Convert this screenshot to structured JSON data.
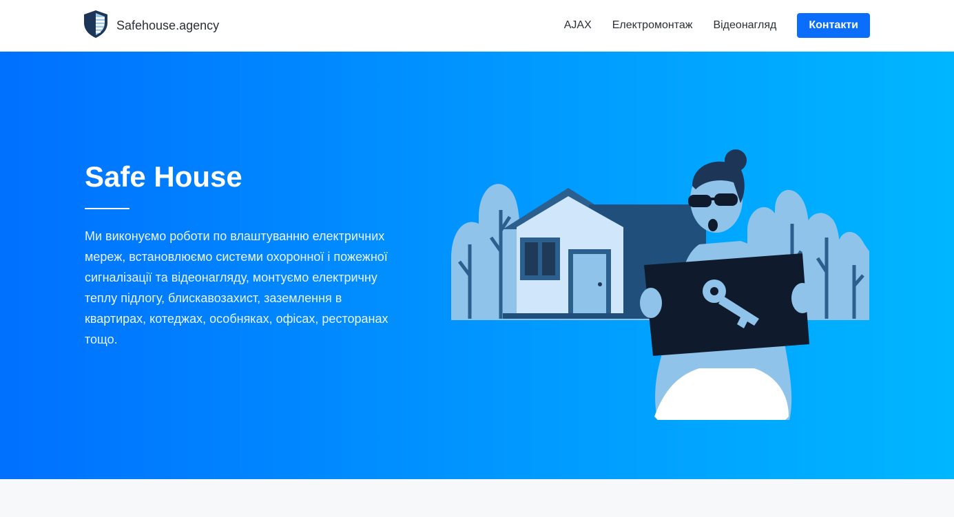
{
  "brand": {
    "name": "Safehouse.agency",
    "logo_icon": "shield-icon",
    "colors": {
      "shield_dark": "#1d3557",
      "shield_light": "#9cc8ea"
    }
  },
  "nav": {
    "items": [
      {
        "label": "AJAX"
      },
      {
        "label": "Електромонтаж"
      },
      {
        "label": "Відеонагляд"
      }
    ],
    "cta_label": "Контакти"
  },
  "hero": {
    "title": "Safe House",
    "description": "Ми виконуємо роботи по влаштуванню електричних мереж, встановлюємо системи охоронної і пожежної сигналізації та відеонагляду, монтуємо електричну теплу підлогу, блискавозахист, заземлення в квартирах, котеджах, особняках, офісах, ресторанах тощо.",
    "illustration": "woman-holding-key-sign-in-front-of-house"
  },
  "colors": {
    "accent": "#0b6dfb",
    "hero_gradient_start": "#0070ff",
    "hero_gradient_end": "#00b6ff",
    "illustration_dark": "#0f1b2d",
    "illustration_light": "#8fc3ea"
  }
}
